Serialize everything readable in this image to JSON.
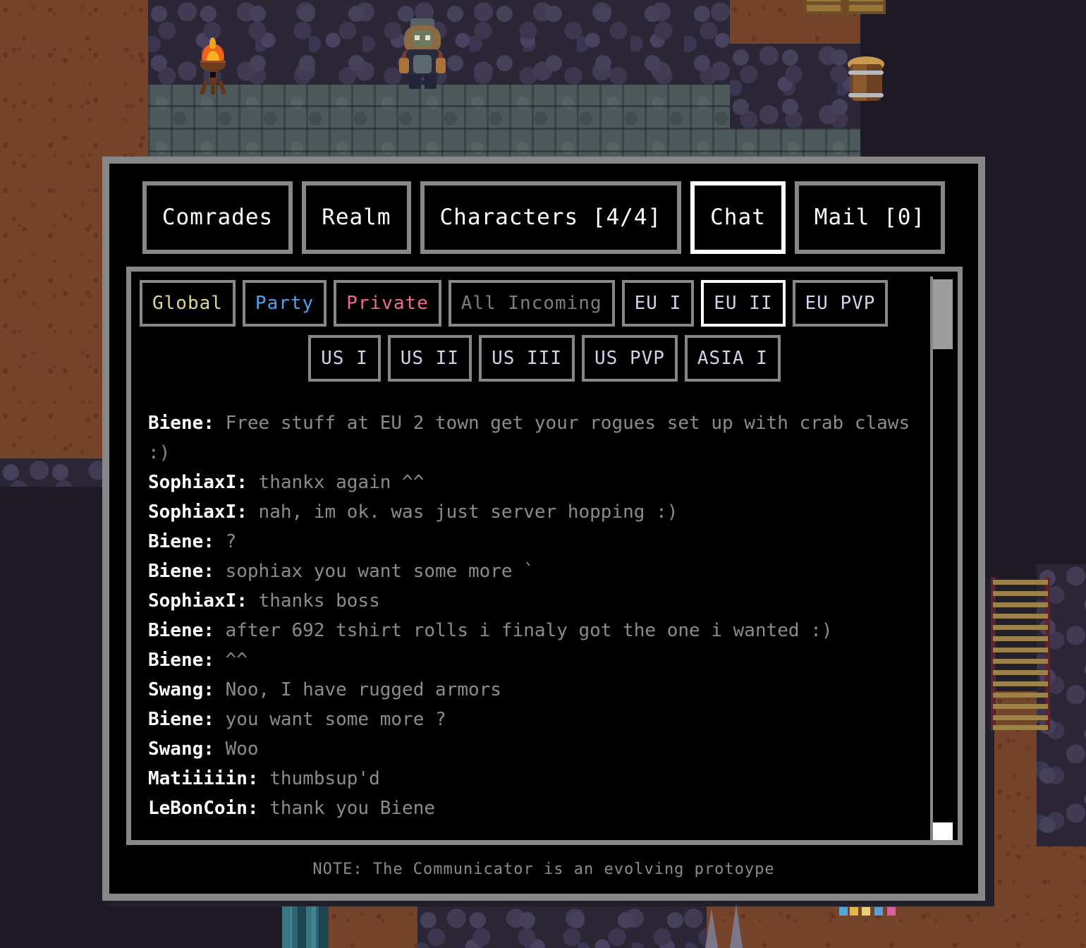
{
  "window": {
    "title": "Communicator",
    "note": "NOTE: The Communicator is an evolving protoype"
  },
  "main_tabs": [
    {
      "label": "Comrades",
      "active": false
    },
    {
      "label": "Realm",
      "active": false
    },
    {
      "label": "Characters [4/4]",
      "active": false
    },
    {
      "label": "Chat",
      "active": true
    },
    {
      "label": "Mail [0]",
      "active": false
    }
  ],
  "channel_tabs_row1": [
    {
      "label": "Global",
      "color": "#d9d98a",
      "active": false
    },
    {
      "label": "Party",
      "color": "#4aa3ef",
      "active": false
    },
    {
      "label": "Private",
      "color": "#f0689b",
      "active": false
    },
    {
      "label": "All Incoming",
      "color": "#7d7d7d",
      "active": false
    },
    {
      "label": "EU I",
      "color": "#cdd4ea",
      "active": false
    },
    {
      "label": "EU II",
      "color": "#cdd4ea",
      "active": true
    },
    {
      "label": "EU PVP",
      "color": "#cdd4ea",
      "active": false
    }
  ],
  "channel_tabs_row2": [
    {
      "label": "US I",
      "color": "#cdd4ea",
      "active": false
    },
    {
      "label": "US II",
      "color": "#cdd4ea",
      "active": false
    },
    {
      "label": "US III",
      "color": "#cdd4ea",
      "active": false
    },
    {
      "label": "US PVP",
      "color": "#cdd4ea",
      "active": false
    },
    {
      "label": "ASIA I",
      "color": "#cdd4ea",
      "active": false
    }
  ],
  "messages": [
    {
      "user": "Biene",
      "text": "Free stuff at EU 2 town get your rogues set up with crab claws :)"
    },
    {
      "user": "SophiaxI",
      "text": "thankx again ^^"
    },
    {
      "user": "SophiaxI",
      "text": "nah, im ok. was just server hopping :)"
    },
    {
      "user": "Biene",
      "text": "?"
    },
    {
      "user": "Biene",
      "text": "sophiax you want some more `"
    },
    {
      "user": "SophiaxI",
      "text": "thanks boss"
    },
    {
      "user": "Biene",
      "text": "after 692 tshirt rolls i finaly got the one i wanted :)"
    },
    {
      "user": "Biene",
      "text": "^^"
    },
    {
      "user": "Swang",
      "text": "Noo, I have rugged armors"
    },
    {
      "user": "Biene",
      "text": "you want some more ?"
    },
    {
      "user": "Swang",
      "text": "Woo"
    },
    {
      "user": "Matiiiiin",
      "text": "thumbsup'd"
    },
    {
      "user": "LeBonCoin",
      "text": "thank you Biene"
    }
  ],
  "scrollbar": {
    "thumb_position_percent": 0,
    "down_button_label": ""
  },
  "colors": {
    "panel_border": "#878787",
    "panel_bg": "#000000",
    "active_border": "#ffffff",
    "username": "#ffffff",
    "message": "#8b8b8b"
  }
}
